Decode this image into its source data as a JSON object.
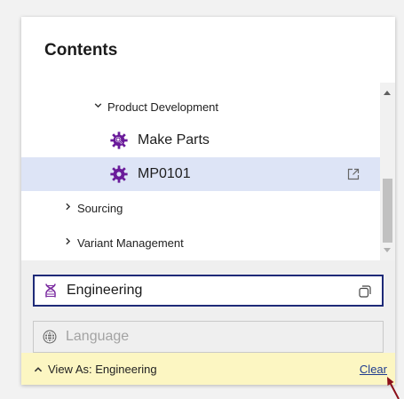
{
  "panel": {
    "title": "Contents"
  },
  "tree": {
    "items": [
      {
        "label": "Product Development",
        "state": "expanded",
        "level": 1
      },
      {
        "label": "Make Parts",
        "icon": "gear-search-icon",
        "level": 2
      },
      {
        "label": "MP0101",
        "icon": "gear-icon",
        "level": 2,
        "selected": true,
        "action_icon": "open-external-icon"
      },
      {
        "label": "Sourcing",
        "state": "collapsed",
        "level": 0
      },
      {
        "label": "Variant Management",
        "state": "collapsed",
        "level": 0
      }
    ]
  },
  "view_as_field": {
    "value": "Engineering",
    "icon": "dna-icon",
    "action_icon": "copy-icon"
  },
  "language_field": {
    "placeholder": "Language",
    "icon": "globe-icon",
    "disabled": true
  },
  "footer": {
    "label": "View As: Engineering",
    "clear_label": "Clear"
  },
  "colors": {
    "accent_border": "#1e2a78",
    "selected_row": "#dde4f6",
    "gear": "#6a1b9a",
    "footer_bg": "#fcf6c2",
    "link": "#1f3c8f",
    "annotation_arrow": "#8b0f1a"
  }
}
